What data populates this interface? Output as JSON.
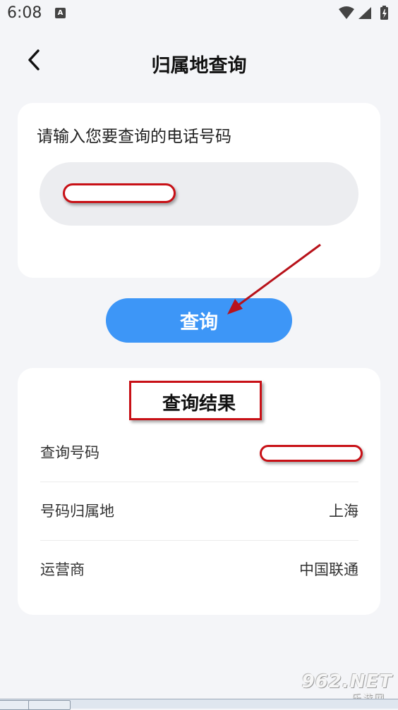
{
  "status_bar": {
    "time": "6:08",
    "notification_icon": "A"
  },
  "header": {
    "title": "归属地查询",
    "back_icon": "chevron-left-icon"
  },
  "input_card": {
    "label": "请输入您要查询的电话号码",
    "phone_value": ""
  },
  "query_button": {
    "label": "查询"
  },
  "result_card": {
    "title": "查询结果",
    "rows": [
      {
        "label": "查询号码",
        "value": ""
      },
      {
        "label": "号码归属地",
        "value": "上海"
      },
      {
        "label": "运营商",
        "value": "中国联通"
      }
    ]
  },
  "watermark": {
    "main": "962.NET",
    "sub": "乐游网"
  },
  "colors": {
    "accent": "#3d96f7",
    "annotation_red": "#c81016",
    "background": "#f4f5f8"
  }
}
